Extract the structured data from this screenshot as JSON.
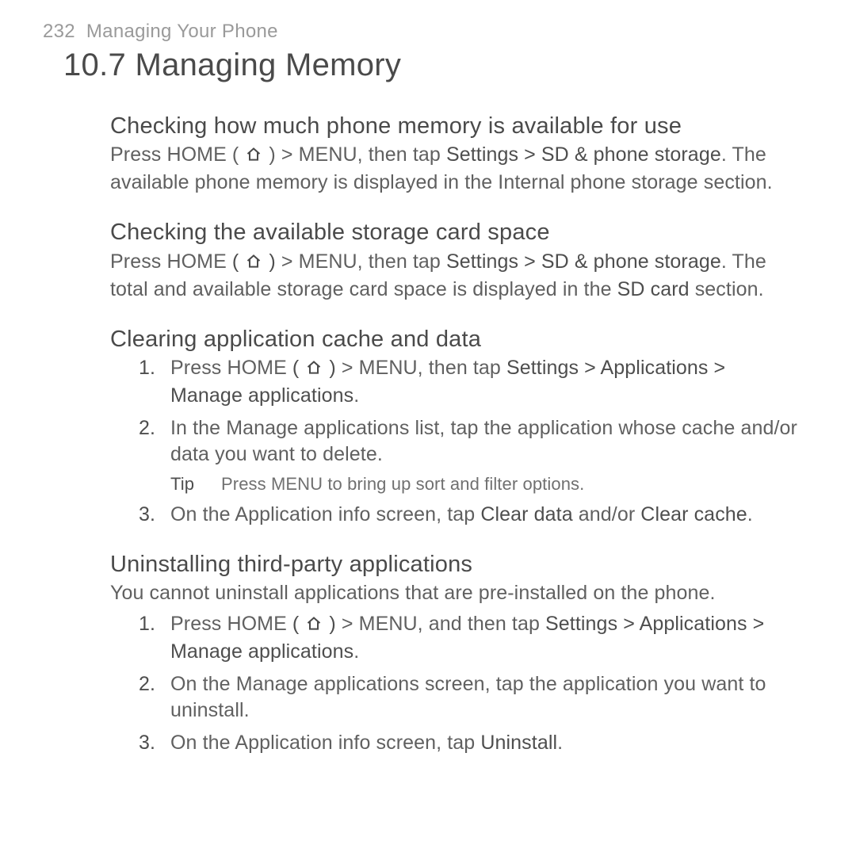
{
  "header": {
    "page_num": "232",
    "running_title": "Managing Your Phone"
  },
  "chapter_title": "10.7  Managing Memory",
  "sec1": {
    "title": "Checking how much phone memory is available for use",
    "p_a": "Press HOME ( ",
    "p_b": " ) > MENU, then tap ",
    "p_c": "Settings > SD & phone storage",
    "p_d": ". The available phone memory is displayed in the Internal phone storage section."
  },
  "sec2": {
    "title": "Checking the available storage card space",
    "p_a": "Press HOME ",
    "p_b": " > MENU, then tap ",
    "p_c": "Settings > SD & phone storage",
    "p_d": ". The total and available storage card space is displayed in the ",
    "p_e": "SD card",
    "p_f": " section."
  },
  "sec3": {
    "title": "Clearing application cache and data",
    "s1_a": "Press HOME ",
    "s1_b": " > MENU, then tap ",
    "s1_c": "Settings > Applications > Manage applications",
    "s1_d": ".",
    "s2": "In the Manage applications list, tap the application whose cache and/or data you want to delete.",
    "tip_label": "Tip",
    "tip_text": "Press MENU to bring up sort and filter options.",
    "s3_a": "On the Application info screen, tap ",
    "s3_b": "Clear data",
    "s3_c": " and/or ",
    "s3_d": "Clear cache",
    "s3_e": "."
  },
  "sec4": {
    "title": "Uninstalling third-party applications",
    "intro": "You cannot uninstall applications that are pre-installed on the phone.",
    "s1_a": "Press HOME ",
    "s1_b": " > MENU, and then tap ",
    "s1_c": "Settings > Applications > Manage applications",
    "s1_d": ".",
    "s2": "On the Manage applications screen, tap the application you want to uninstall.",
    "s3_a": "On the Application info screen, tap ",
    "s3_b": "Uninstall",
    "s3_c": "."
  }
}
